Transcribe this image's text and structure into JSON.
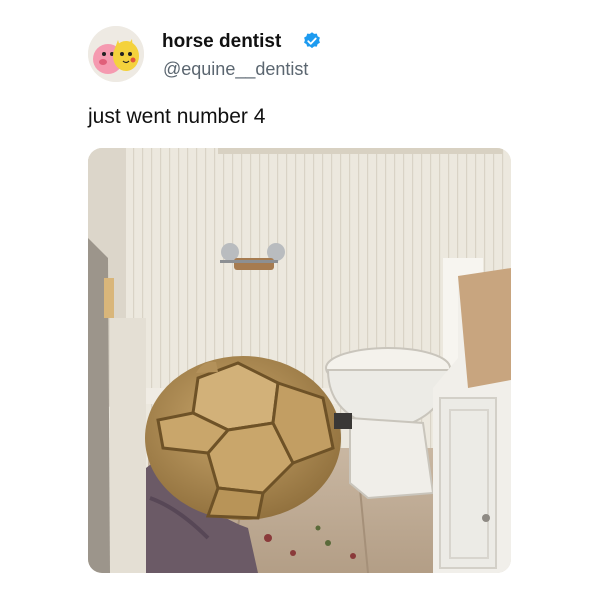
{
  "tweet": {
    "display_name": "horse dentist",
    "handle": "@equine__dentist",
    "verified": true,
    "text": "just went number 4"
  },
  "icons": {
    "avatar": "cartoon-characters-avatar",
    "verified": "verified-badge-icon"
  },
  "colors": {
    "verified_blue": "#1d9bf0",
    "handle_gray": "#5b6670"
  },
  "photo": {
    "subject": "tortoise-next-to-toilet-in-bathroom"
  }
}
